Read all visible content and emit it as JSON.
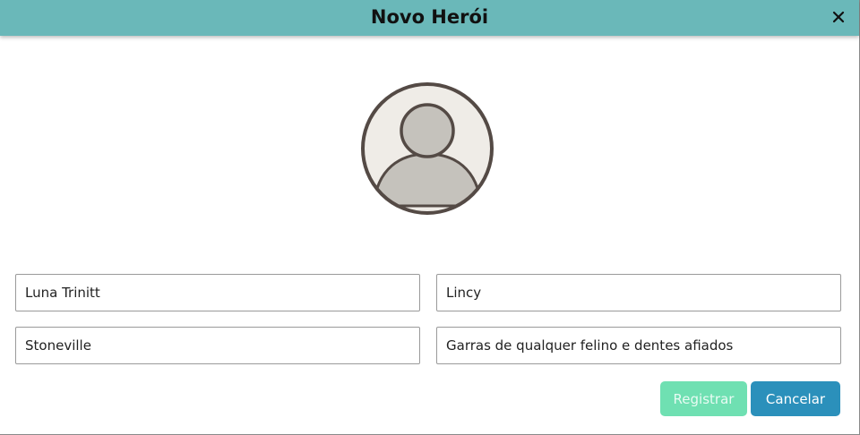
{
  "dialog": {
    "title": "Novo Herói",
    "close_icon": "close-icon"
  },
  "avatar": {
    "icon": "user-avatar-icon",
    "colors": {
      "background": "#efece7",
      "figure": "#c5c2bc",
      "outline": "#544a45"
    }
  },
  "form": {
    "fields": [
      {
        "value": "Luna Trinitt"
      },
      {
        "value": "Lincy"
      },
      {
        "value": "Stoneville"
      },
      {
        "value": "Garras de qualquer felino e dentes afiados"
      }
    ]
  },
  "actions": {
    "register_label": "Registrar",
    "cancel_label": "Cancelar"
  },
  "colors": {
    "header": "#6ab8b9",
    "register_button": "#6fe0b2",
    "cancel_button": "#2b90bb"
  }
}
